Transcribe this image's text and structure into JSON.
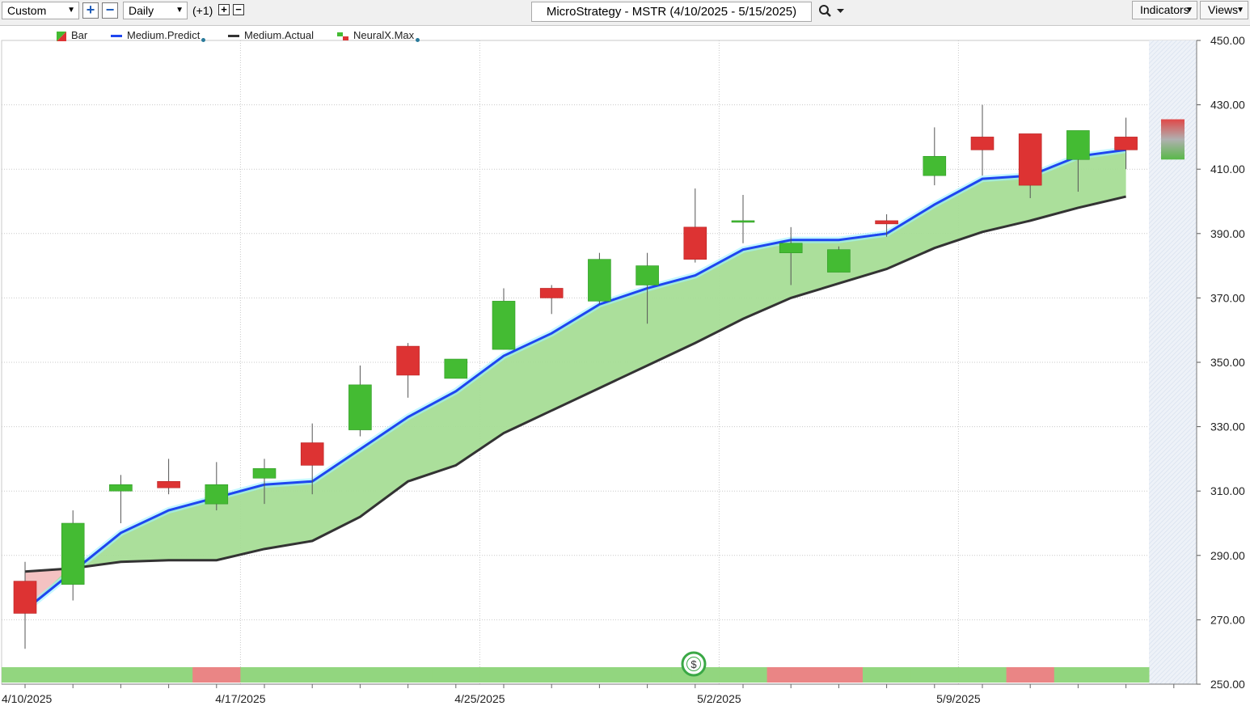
{
  "toolbar": {
    "range_select": "Custom",
    "interval_select": "Daily",
    "plus_one": "(+1)",
    "chart_title": "MicroStrategy - MSTR (4/10/2025 - 5/15/2025)",
    "indicators_label": "Indicators",
    "views_label": "Views"
  },
  "legend": {
    "bar": "Bar",
    "medium_predict": "Medium.Predict",
    "medium_actual": "Medium.Actual",
    "neuralx_max": "NeuralX.Max"
  },
  "marker": {
    "label": "$"
  },
  "colors": {
    "up": "#44bb33",
    "down": "#dd3333",
    "predict": "#1e46f0",
    "actual": "#333333",
    "fill": "#a6dd96",
    "fill_neg": "#f4c2c2",
    "strip_up": "#92d67f",
    "strip_down": "#ea8585"
  },
  "chart_data": {
    "type": "candlestick",
    "y_ticks": [
      "450.00",
      "430.00",
      "410.00",
      "390.00",
      "370.00",
      "350.00",
      "330.00",
      "310.00",
      "290.00",
      "270.00",
      "250.00"
    ],
    "ylim": [
      250,
      450
    ],
    "x_labels": [
      {
        "label": "4/10/2025",
        "index": 0
      },
      {
        "label": "4/17/2025",
        "index": 4.5
      },
      {
        "label": "4/25/2025",
        "index": 9.5
      },
      {
        "label": "5/2/2025",
        "index": 14.5
      },
      {
        "label": "5/9/2025",
        "index": 19.5
      }
    ],
    "candles": [
      {
        "o": 282,
        "h": 288,
        "l": 261,
        "c": 272
      },
      {
        "o": 281,
        "h": 304,
        "l": 276,
        "c": 300
      },
      {
        "o": 310,
        "h": 315,
        "l": 300,
        "c": 312
      },
      {
        "o": 313,
        "h": 320,
        "l": 309,
        "c": 311
      },
      {
        "o": 306,
        "h": 319,
        "l": 304,
        "c": 312
      },
      {
        "o": 314,
        "h": 320,
        "l": 306,
        "c": 317
      },
      {
        "o": 325,
        "h": 331,
        "l": 309,
        "c": 318
      },
      {
        "o": 329,
        "h": 349,
        "l": 327,
        "c": 343
      },
      {
        "o": 355,
        "h": 356,
        "l": 339,
        "c": 346
      },
      {
        "o": 345,
        "h": 351,
        "l": 345,
        "c": 351
      },
      {
        "o": 354,
        "h": 373,
        "l": 354,
        "c": 369
      },
      {
        "o": 373,
        "h": 374,
        "l": 365,
        "c": 370
      },
      {
        "o": 369,
        "h": 384,
        "l": 368,
        "c": 382
      },
      {
        "o": 374,
        "h": 384,
        "l": 362,
        "c": 380
      },
      {
        "o": 392,
        "h": 404,
        "l": 381,
        "c": 382
      },
      {
        "o": 394,
        "h": 402,
        "l": 387,
        "c": 394
      },
      {
        "o": 384,
        "h": 392,
        "l": 374,
        "c": 387
      },
      {
        "o": 378,
        "h": 386,
        "l": 378,
        "c": 385
      },
      {
        "o": 394,
        "h": 396,
        "l": 389,
        "c": 393
      },
      {
        "o": 408,
        "h": 423,
        "l": 405,
        "c": 414
      },
      {
        "o": 420,
        "h": 430,
        "l": 408,
        "c": 416
      },
      {
        "o": 421,
        "h": 421,
        "l": 401,
        "c": 405
      },
      {
        "o": 413,
        "h": 422,
        "l": 403,
        "c": 422
      },
      {
        "o": 420,
        "h": 426,
        "l": 410,
        "c": 416
      }
    ],
    "series": [
      {
        "name": "Medium.Predict",
        "values": [
          273,
          285,
          297,
          304,
          308,
          312,
          313,
          323,
          333,
          341,
          352,
          359,
          368,
          373,
          377,
          385,
          388,
          388,
          390,
          399,
          407,
          408,
          414,
          416
        ]
      },
      {
        "name": "Medium.Actual",
        "values": [
          285,
          286,
          288,
          288.5,
          288.5,
          292,
          294.5,
          302,
          313,
          318,
          328,
          335,
          342,
          349,
          356,
          363.5,
          370,
          374.5,
          379,
          385.5,
          390.5,
          394,
          398,
          401.5
        ]
      }
    ],
    "neuralx_max": {
      "high": 425,
      "low": 413
    },
    "signal_strip": [
      "up",
      "up",
      "up",
      "up",
      "down",
      "up",
      "up",
      "up",
      "up",
      "up",
      "up",
      "up",
      "up",
      "up",
      "up",
      "up",
      "down",
      "down",
      "up",
      "up",
      "up",
      "down",
      "up",
      "up"
    ]
  }
}
